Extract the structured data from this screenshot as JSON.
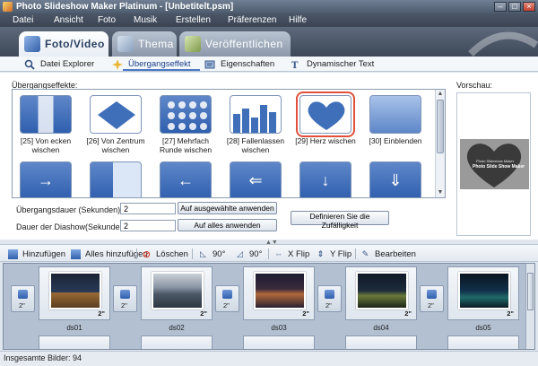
{
  "window": {
    "title": "Photo Slideshow Maker Platinum - [Unbetitelt.psm]"
  },
  "menu": [
    "Datei",
    "Ansicht",
    "Foto",
    "Musik",
    "Erstellen",
    "Präferenzen",
    "Hilfe"
  ],
  "main_tabs": [
    {
      "label": "Foto/Video",
      "active": true
    },
    {
      "label": "Thema",
      "active": false
    },
    {
      "label": "Veröffentlichen",
      "active": false
    }
  ],
  "sub_tabs": [
    {
      "label": "Datei Explorer",
      "icon": "magnifier-icon"
    },
    {
      "label": "Übergangseffekt",
      "icon": "sparkle-icon",
      "active": true
    },
    {
      "label": "Eigenschaften",
      "icon": "properties-icon"
    },
    {
      "label": "Dynamischer Text",
      "icon": "text-icon"
    }
  ],
  "transitions": {
    "label": "Übergangseffekte:",
    "items": [
      {
        "caption": "[25] Von ecken wischen"
      },
      {
        "caption": "[26] Von Zentrum wischen"
      },
      {
        "caption": "[27] Mehrfach Runde wischen"
      },
      {
        "caption": "[28] Fallenlassen wischen"
      },
      {
        "caption": "[29] Herz wischen",
        "selected": true
      },
      {
        "caption": "[30] Einblenden"
      }
    ],
    "selection_color": "#e0503a"
  },
  "settings": {
    "transition_duration_label": "Übergangsdauer (Sekunden):",
    "transition_duration_value": "2",
    "apply_selected_label": "Auf ausgewählte anwenden",
    "slideshow_duration_label": "Dauer der Diashow(Sekunden):",
    "slideshow_duration_value": "2",
    "apply_all_label": "Auf alles anwenden",
    "define_random_label": "Definieren Sie die Zufälligkeit"
  },
  "preview": {
    "label": "Vorschau:",
    "line1": "Photo Slideshow Maker",
    "line2": "Photo Slide Show Maker"
  },
  "toolbar": {
    "add": "Hinzufügen",
    "add_all": "Alles hinzufügen",
    "delete": "Löschen",
    "rotate_left": "90°",
    "rotate_right": "90°",
    "xflip": "X Flip",
    "yflip": "Y Flip",
    "edit": "Bearbeiten"
  },
  "storyboard": {
    "transition_duration": "2\"",
    "slides": [
      {
        "label": "ds01",
        "duration": "2\""
      },
      {
        "label": "ds02",
        "duration": "2\""
      },
      {
        "label": "ds03",
        "duration": "2\""
      },
      {
        "label": "ds04",
        "duration": "2\""
      },
      {
        "label": "ds05",
        "duration": "2\""
      }
    ]
  },
  "status": {
    "text": "Insgesamte Bilder: 94"
  }
}
